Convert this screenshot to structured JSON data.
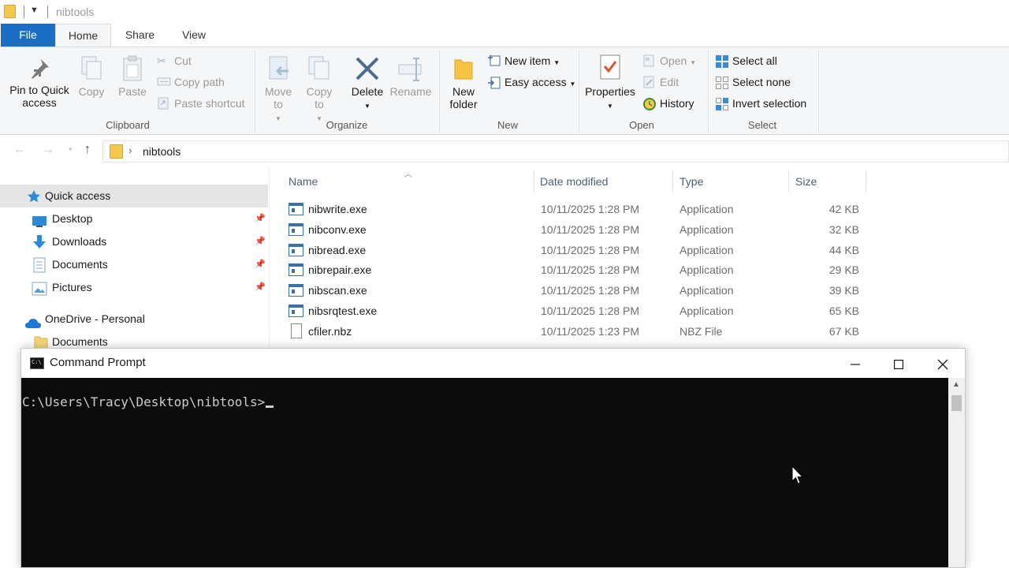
{
  "window": {
    "title": "nibtools"
  },
  "ribbon_tabs": [
    "File",
    "Home",
    "Share",
    "View"
  ],
  "ribbon": {
    "clipboard": {
      "label": "Clipboard",
      "pin_to_quick_access": "Pin to Quick access",
      "copy": "Copy",
      "paste": "Paste",
      "cut": "Cut",
      "copy_path": "Copy path",
      "paste_shortcut": "Paste shortcut"
    },
    "organize": {
      "label": "Organize",
      "move_to": "Move to",
      "copy_to": "Copy to",
      "delete": "Delete",
      "rename": "Rename"
    },
    "new": {
      "label": "New",
      "new_folder": "New folder",
      "new_item": "New item",
      "easy_access": "Easy access"
    },
    "open": {
      "label": "Open",
      "properties": "Properties",
      "open": "Open",
      "edit": "Edit",
      "history": "History"
    },
    "select": {
      "label": "Select",
      "select_all": "Select all",
      "select_none": "Select none",
      "invert_selection": "Invert selection"
    }
  },
  "address": {
    "path": "nibtools"
  },
  "nav_pane": {
    "items": [
      {
        "label": "Quick access",
        "icon": "star-icon",
        "selected": true
      },
      {
        "label": "Desktop",
        "icon": "desktop-icon",
        "pinned": true
      },
      {
        "label": "Downloads",
        "icon": "download-arrow-icon",
        "pinned": true
      },
      {
        "label": "Documents",
        "icon": "documents-icon",
        "pinned": true
      },
      {
        "label": "Pictures",
        "icon": "pictures-icon",
        "pinned": true
      },
      {
        "label": "OneDrive - Personal",
        "icon": "cloud-icon"
      },
      {
        "label": "Documents",
        "icon": "folder-icon"
      }
    ]
  },
  "file_list": {
    "columns": [
      "Name",
      "Date modified",
      "Type",
      "Size"
    ],
    "rows": [
      {
        "name": "nibwrite.exe",
        "date": "10/11/2025 1:28 PM",
        "type": "Application",
        "size": "42 KB",
        "icon": "application-icon"
      },
      {
        "name": "nibconv.exe",
        "date": "10/11/2025 1:28 PM",
        "type": "Application",
        "size": "32 KB",
        "icon": "application-icon"
      },
      {
        "name": "nibread.exe",
        "date": "10/11/2025 1:28 PM",
        "type": "Application",
        "size": "44 KB",
        "icon": "application-icon"
      },
      {
        "name": "nibrepair.exe",
        "date": "10/11/2025 1:28 PM",
        "type": "Application",
        "size": "29 KB",
        "icon": "application-icon"
      },
      {
        "name": "nibscan.exe",
        "date": "10/11/2025 1:28 PM",
        "type": "Application",
        "size": "39 KB",
        "icon": "application-icon"
      },
      {
        "name": "nibsrqtest.exe",
        "date": "10/11/2025 1:28 PM",
        "type": "Application",
        "size": "65 KB",
        "icon": "application-icon"
      },
      {
        "name": "cfiler.nbz",
        "date": "10/11/2025 1:23 PM",
        "type": "NBZ File",
        "size": "67 KB",
        "icon": "file-icon"
      }
    ]
  },
  "command_prompt": {
    "title": "Command Prompt",
    "prompt": "C:\\Users\\Tracy\\Desktop\\nibtools>"
  },
  "colors": {
    "file_tab": "#1a6fc4",
    "console_bg": "#0c0c0c",
    "console_text": "#cccccc",
    "column_header": "#4c607a"
  }
}
